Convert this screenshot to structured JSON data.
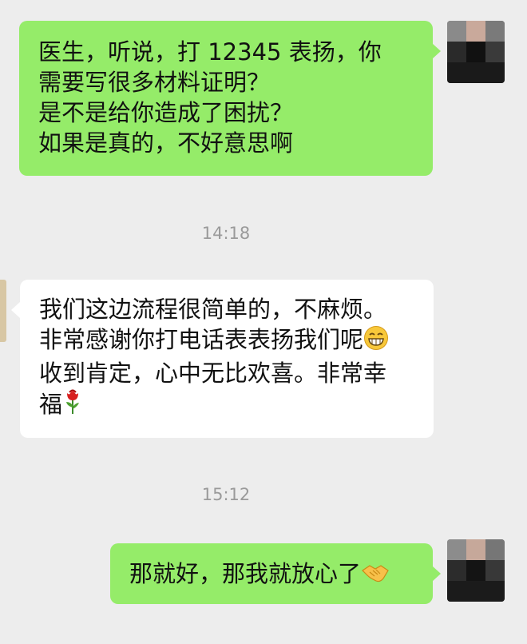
{
  "messages": [
    {
      "id": "m1",
      "side": "right",
      "lines": [
        "医生，听说，打 12345 表扬，你",
        "需要写很多材料证明？",
        "是不是给你造成了困扰？",
        "如果是真的，不好意思啊"
      ]
    },
    {
      "id": "m2",
      "side": "left",
      "lines": [
        "我们这边流程很简单的，不麻烦。",
        "非常感谢你打电话表表扬我们呢",
        "收到肯定，心中无比欢喜。非常幸",
        "福"
      ],
      "emojis": [
        "grin-emoji",
        "rose-emoji"
      ]
    },
    {
      "id": "m3",
      "side": "right",
      "lines": [
        "那就好，那我就放心了"
      ],
      "emojis": [
        "handshake-emoji"
      ]
    }
  ],
  "timestamps": [
    "14:18",
    "15:12"
  ],
  "colors": {
    "background": "#ededed",
    "sent_bubble": "#95ec69",
    "received_bubble": "#ffffff",
    "timestamp": "#9a9a9a"
  }
}
